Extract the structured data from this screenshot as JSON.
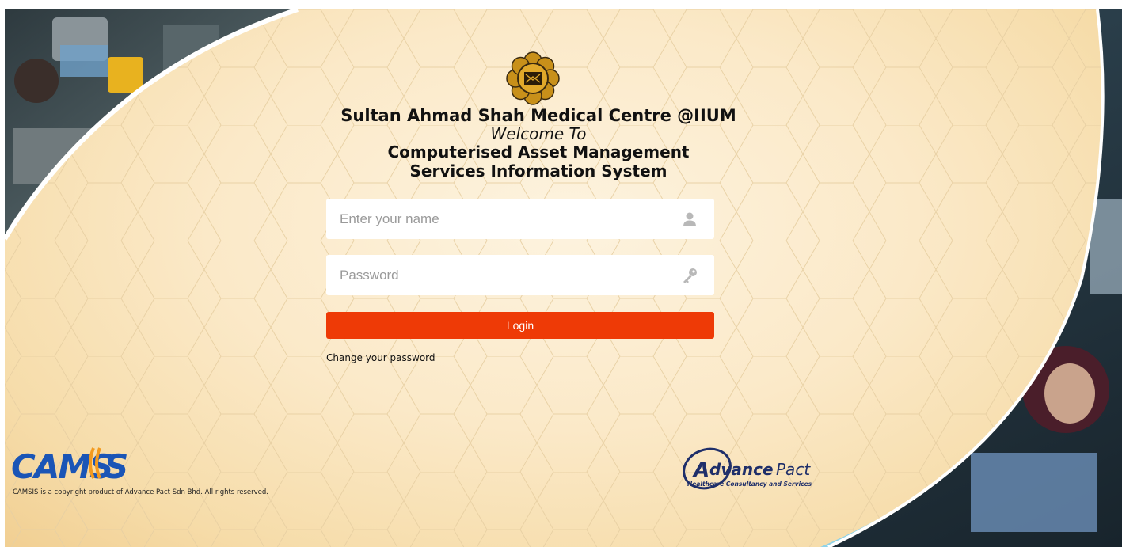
{
  "header": {
    "organization": "Sultan Ahmad Shah Medical Centre @IIUM",
    "welcome": "Welcome To",
    "system_line1": "Computerised Asset Management",
    "system_line2": "Services Information System"
  },
  "form": {
    "username_placeholder": "Enter your name",
    "username_value": "",
    "username_icon": "user-icon",
    "password_placeholder": "Password",
    "password_value": "",
    "password_icon": "key-icon",
    "login_label": "Login",
    "change_password_label": "Change your password"
  },
  "footer": {
    "camsis_logo_text": "CAMSIS",
    "copyright": "CAMSIS is a copyright product of Advance Pact Sdn Bhd. All rights reserved.",
    "advancepact_logo_text": "AdvancePact",
    "advancepact_tagline": "Healthcare Consultancy and Services"
  },
  "colors": {
    "login_button": "#ee3a06",
    "background": "#fbe9c8",
    "accent_teal": "#8fd3e8",
    "camsis_blue": "#1a55b6",
    "camsis_orange": "#f39a1e"
  }
}
